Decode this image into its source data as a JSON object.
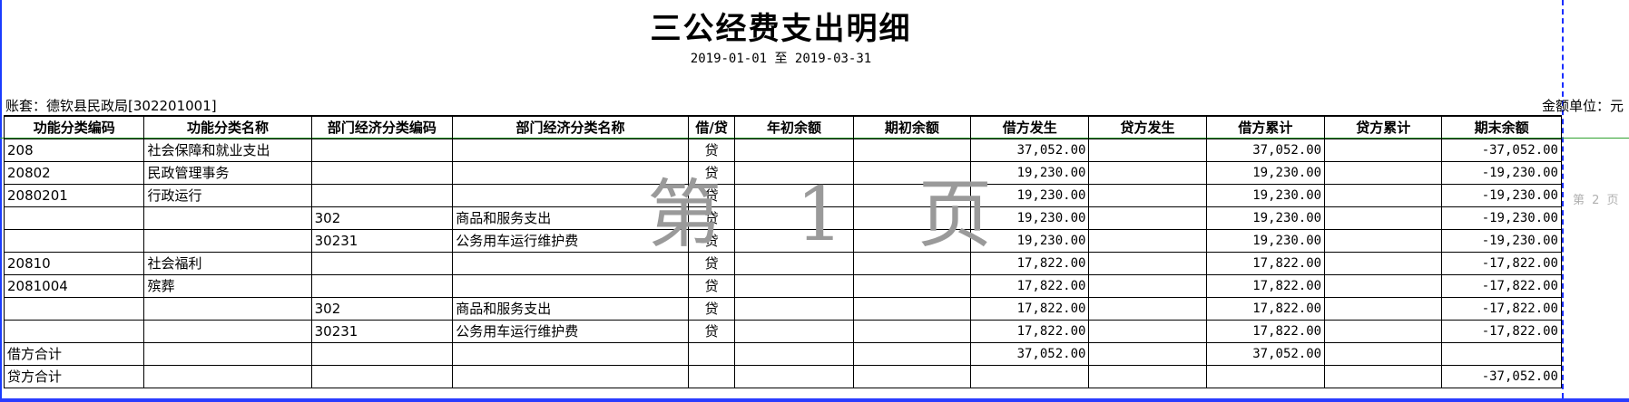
{
  "report": {
    "title": "三公经费支出明细",
    "date_range": "2019-01-01 至 2019-03-31",
    "ledger": "账套：德钦县民政局[302201001]",
    "unit": "金额单位：元"
  },
  "watermark": "第 1 页",
  "next_page_label": "第 2 页",
  "columns": [
    "功能分类编码",
    "功能分类名称",
    "部门经济分类编码",
    "部门经济分类名称",
    "借/贷",
    "年初余额",
    "期初余额",
    "借方发生",
    "贷方发生",
    "借方累计",
    "贷方累计",
    "期末余额"
  ],
  "rows": [
    [
      "208",
      "社会保障和就业支出",
      "",
      "",
      "贷",
      "",
      "",
      "37,052.00",
      "",
      "37,052.00",
      "",
      "-37,052.00"
    ],
    [
      "20802",
      "民政管理事务",
      "",
      "",
      "贷",
      "",
      "",
      "19,230.00",
      "",
      "19,230.00",
      "",
      "-19,230.00"
    ],
    [
      "2080201",
      "行政运行",
      "",
      "",
      "贷",
      "",
      "",
      "19,230.00",
      "",
      "19,230.00",
      "",
      "-19,230.00"
    ],
    [
      "",
      "",
      "302",
      "商品和服务支出",
      "贷",
      "",
      "",
      "19,230.00",
      "",
      "19,230.00",
      "",
      "-19,230.00"
    ],
    [
      "",
      "",
      "30231",
      "公务用车运行维护费",
      "贷",
      "",
      "",
      "19,230.00",
      "",
      "19,230.00",
      "",
      "-19,230.00"
    ],
    [
      "20810",
      "社会福利",
      "",
      "",
      "贷",
      "",
      "",
      "17,822.00",
      "",
      "17,822.00",
      "",
      "-17,822.00"
    ],
    [
      "2081004",
      "殡葬",
      "",
      "",
      "贷",
      "",
      "",
      "17,822.00",
      "",
      "17,822.00",
      "",
      "-17,822.00"
    ],
    [
      "",
      "",
      "302",
      "商品和服务支出",
      "贷",
      "",
      "",
      "17,822.00",
      "",
      "17,822.00",
      "",
      "-17,822.00"
    ],
    [
      "",
      "",
      "30231",
      "公务用车运行维护费",
      "贷",
      "",
      "",
      "17,822.00",
      "",
      "17,822.00",
      "",
      "-17,822.00"
    ]
  ],
  "totals": [
    [
      "借方合计",
      "",
      "",
      "",
      "",
      "",
      "",
      "37,052.00",
      "",
      "37,052.00",
      "",
      ""
    ],
    [
      "贷方合计",
      "",
      "",
      "",
      "",
      "",
      "",
      "",
      "",
      "",
      "",
      "-37,052.00"
    ]
  ]
}
